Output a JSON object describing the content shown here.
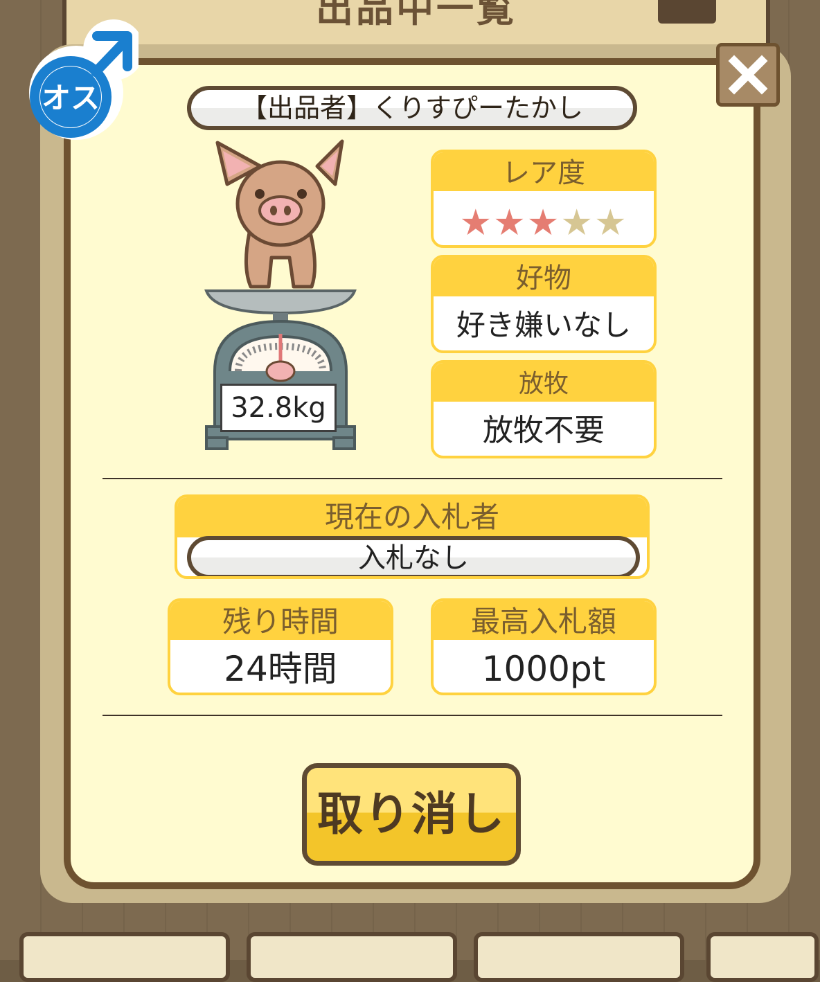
{
  "background": {
    "title_partial": "出品中一覧"
  },
  "gender": {
    "label": "オス",
    "icon": "male-symbol-icon",
    "color": "#1a7fcf"
  },
  "seller": {
    "text": "【出品者】くりすぴーたかし"
  },
  "pig": {
    "weight": "32.8kg"
  },
  "rarity": {
    "label": "レア度",
    "stars_filled": 3,
    "stars_total": 5
  },
  "favorite": {
    "label": "好物",
    "value": "好き嫌いなし"
  },
  "grazing": {
    "label": "放牧",
    "value": "放牧不要"
  },
  "bidder": {
    "label": "現在の入札者",
    "value": "入札なし"
  },
  "remaining": {
    "label": "残り時間",
    "value": "24時間"
  },
  "max_bid": {
    "label": "最高入札額",
    "value": "1000pt"
  },
  "cancel_button": {
    "label": "取り消し"
  },
  "colors": {
    "panel_bg": "#fffbd0",
    "header_yellow": "#ffd23f",
    "border_brown": "#6e5230",
    "star_on": "#e57d72",
    "star_off": "#d6c693"
  }
}
